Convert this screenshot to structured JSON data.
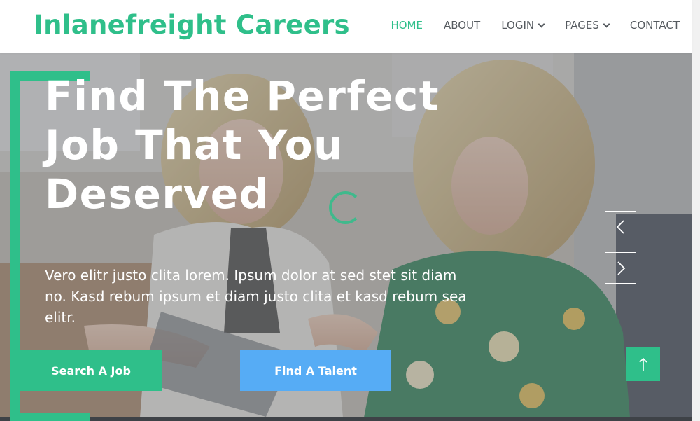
{
  "brand": {
    "name": "Inlanefreight Careers"
  },
  "nav": {
    "items": [
      {
        "label": "HOME",
        "active": true,
        "dropdown": false
      },
      {
        "label": "ABOUT",
        "active": false,
        "dropdown": false
      },
      {
        "label": "LOGIN",
        "active": false,
        "dropdown": true
      },
      {
        "label": "PAGES",
        "active": false,
        "dropdown": true
      },
      {
        "label": "CONTACT",
        "active": false,
        "dropdown": false
      }
    ]
  },
  "hero": {
    "title": "Find The Perfect Job That You Deserved",
    "description": "Vero elitr justo clita lorem. Ipsum dolor at sed stet sit diam no. Kasd rebum ipsum et diam justo clita et kasd rebum sea elitr.",
    "primary_button": "Search A Job",
    "secondary_button": "Find A Talent"
  },
  "icons": {
    "prev": "chevron-left-icon",
    "next": "chevron-right-icon",
    "back_to_top": "arrow-up-icon",
    "loading": "spinner-icon"
  },
  "colors": {
    "accent": "#2fbf8a",
    "secondary": "#56acf5",
    "nav_text": "#555a5f"
  }
}
